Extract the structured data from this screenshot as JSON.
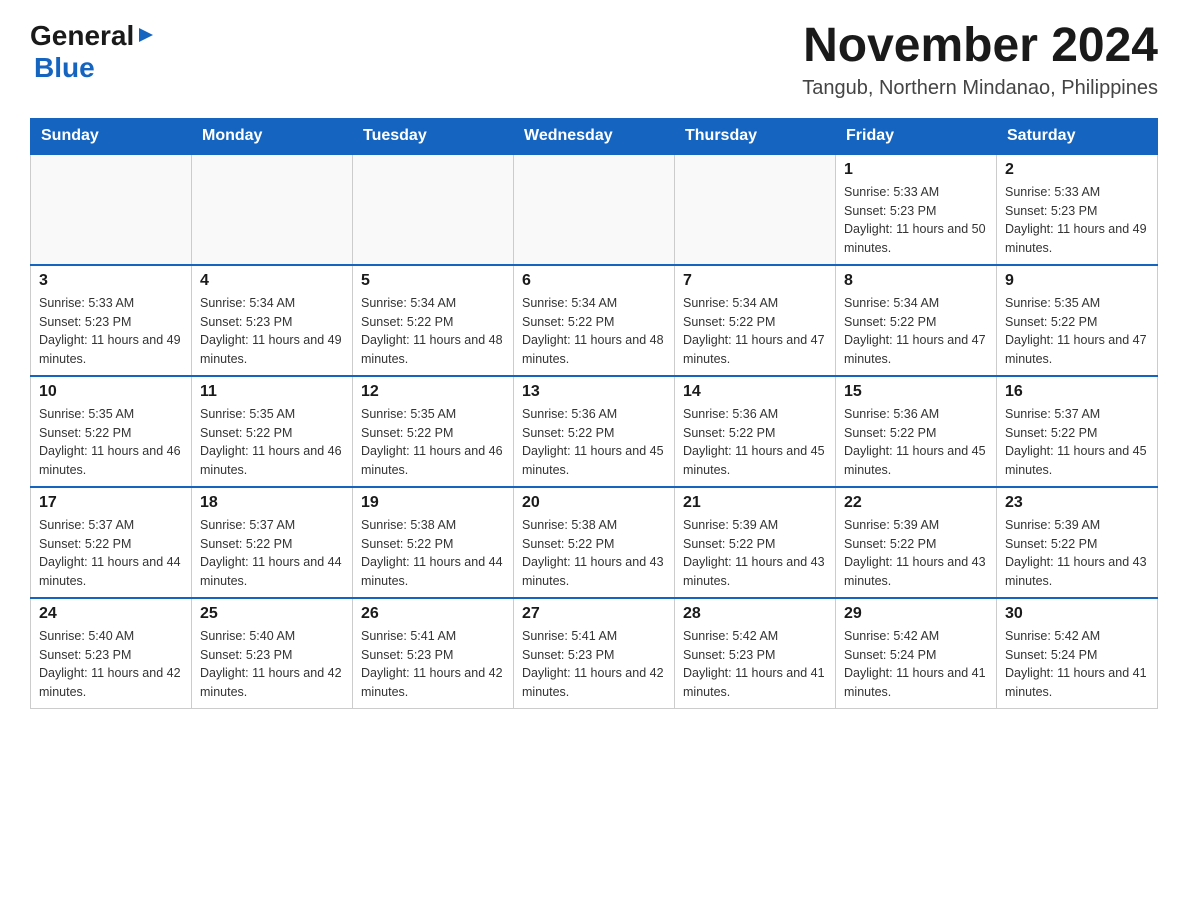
{
  "header": {
    "logo_general": "General",
    "logo_blue": "Blue",
    "month_title": "November 2024",
    "location": "Tangub, Northern Mindanao, Philippines"
  },
  "weekdays": [
    "Sunday",
    "Monday",
    "Tuesday",
    "Wednesday",
    "Thursday",
    "Friday",
    "Saturday"
  ],
  "weeks": [
    [
      {
        "day": "",
        "info": ""
      },
      {
        "day": "",
        "info": ""
      },
      {
        "day": "",
        "info": ""
      },
      {
        "day": "",
        "info": ""
      },
      {
        "day": "",
        "info": ""
      },
      {
        "day": "1",
        "info": "Sunrise: 5:33 AM\nSunset: 5:23 PM\nDaylight: 11 hours and 50 minutes."
      },
      {
        "day": "2",
        "info": "Sunrise: 5:33 AM\nSunset: 5:23 PM\nDaylight: 11 hours and 49 minutes."
      }
    ],
    [
      {
        "day": "3",
        "info": "Sunrise: 5:33 AM\nSunset: 5:23 PM\nDaylight: 11 hours and 49 minutes."
      },
      {
        "day": "4",
        "info": "Sunrise: 5:34 AM\nSunset: 5:23 PM\nDaylight: 11 hours and 49 minutes."
      },
      {
        "day": "5",
        "info": "Sunrise: 5:34 AM\nSunset: 5:22 PM\nDaylight: 11 hours and 48 minutes."
      },
      {
        "day": "6",
        "info": "Sunrise: 5:34 AM\nSunset: 5:22 PM\nDaylight: 11 hours and 48 minutes."
      },
      {
        "day": "7",
        "info": "Sunrise: 5:34 AM\nSunset: 5:22 PM\nDaylight: 11 hours and 47 minutes."
      },
      {
        "day": "8",
        "info": "Sunrise: 5:34 AM\nSunset: 5:22 PM\nDaylight: 11 hours and 47 minutes."
      },
      {
        "day": "9",
        "info": "Sunrise: 5:35 AM\nSunset: 5:22 PM\nDaylight: 11 hours and 47 minutes."
      }
    ],
    [
      {
        "day": "10",
        "info": "Sunrise: 5:35 AM\nSunset: 5:22 PM\nDaylight: 11 hours and 46 minutes."
      },
      {
        "day": "11",
        "info": "Sunrise: 5:35 AM\nSunset: 5:22 PM\nDaylight: 11 hours and 46 minutes."
      },
      {
        "day": "12",
        "info": "Sunrise: 5:35 AM\nSunset: 5:22 PM\nDaylight: 11 hours and 46 minutes."
      },
      {
        "day": "13",
        "info": "Sunrise: 5:36 AM\nSunset: 5:22 PM\nDaylight: 11 hours and 45 minutes."
      },
      {
        "day": "14",
        "info": "Sunrise: 5:36 AM\nSunset: 5:22 PM\nDaylight: 11 hours and 45 minutes."
      },
      {
        "day": "15",
        "info": "Sunrise: 5:36 AM\nSunset: 5:22 PM\nDaylight: 11 hours and 45 minutes."
      },
      {
        "day": "16",
        "info": "Sunrise: 5:37 AM\nSunset: 5:22 PM\nDaylight: 11 hours and 45 minutes."
      }
    ],
    [
      {
        "day": "17",
        "info": "Sunrise: 5:37 AM\nSunset: 5:22 PM\nDaylight: 11 hours and 44 minutes."
      },
      {
        "day": "18",
        "info": "Sunrise: 5:37 AM\nSunset: 5:22 PM\nDaylight: 11 hours and 44 minutes."
      },
      {
        "day": "19",
        "info": "Sunrise: 5:38 AM\nSunset: 5:22 PM\nDaylight: 11 hours and 44 minutes."
      },
      {
        "day": "20",
        "info": "Sunrise: 5:38 AM\nSunset: 5:22 PM\nDaylight: 11 hours and 43 minutes."
      },
      {
        "day": "21",
        "info": "Sunrise: 5:39 AM\nSunset: 5:22 PM\nDaylight: 11 hours and 43 minutes."
      },
      {
        "day": "22",
        "info": "Sunrise: 5:39 AM\nSunset: 5:22 PM\nDaylight: 11 hours and 43 minutes."
      },
      {
        "day": "23",
        "info": "Sunrise: 5:39 AM\nSunset: 5:22 PM\nDaylight: 11 hours and 43 minutes."
      }
    ],
    [
      {
        "day": "24",
        "info": "Sunrise: 5:40 AM\nSunset: 5:23 PM\nDaylight: 11 hours and 42 minutes."
      },
      {
        "day": "25",
        "info": "Sunrise: 5:40 AM\nSunset: 5:23 PM\nDaylight: 11 hours and 42 minutes."
      },
      {
        "day": "26",
        "info": "Sunrise: 5:41 AM\nSunset: 5:23 PM\nDaylight: 11 hours and 42 minutes."
      },
      {
        "day": "27",
        "info": "Sunrise: 5:41 AM\nSunset: 5:23 PM\nDaylight: 11 hours and 42 minutes."
      },
      {
        "day": "28",
        "info": "Sunrise: 5:42 AM\nSunset: 5:23 PM\nDaylight: 11 hours and 41 minutes."
      },
      {
        "day": "29",
        "info": "Sunrise: 5:42 AM\nSunset: 5:24 PM\nDaylight: 11 hours and 41 minutes."
      },
      {
        "day": "30",
        "info": "Sunrise: 5:42 AM\nSunset: 5:24 PM\nDaylight: 11 hours and 41 minutes."
      }
    ]
  ]
}
